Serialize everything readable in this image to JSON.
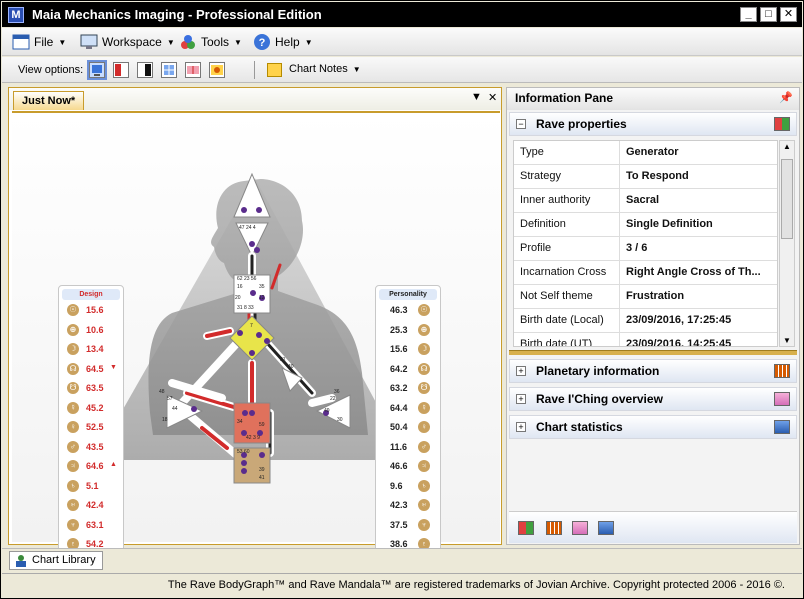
{
  "window": {
    "title": "Maia Mechanics Imaging - Professional Edition",
    "app_icon": "M"
  },
  "menu": {
    "file": "File",
    "workspace": "Workspace",
    "tools": "Tools",
    "help": "Help"
  },
  "toolbar": {
    "view_options": "View options:",
    "chart_notes": "Chart Notes"
  },
  "document": {
    "tab": "Just Now*"
  },
  "design": {
    "header": "Design",
    "rows": [
      {
        "glyph": "☉",
        "value": "15.6",
        "mark": ""
      },
      {
        "glyph": "⊕",
        "value": "10.6",
        "mark": ""
      },
      {
        "glyph": "☽",
        "value": "13.4",
        "mark": ""
      },
      {
        "glyph": "☊",
        "value": "64.5",
        "mark": "▼"
      },
      {
        "glyph": "☋",
        "value": "63.5",
        "mark": ""
      },
      {
        "glyph": "☿",
        "value": "45.2",
        "mark": ""
      },
      {
        "glyph": "♀",
        "value": "52.5",
        "mark": ""
      },
      {
        "glyph": "♂",
        "value": "43.5",
        "mark": ""
      },
      {
        "glyph": "♃",
        "value": "64.6",
        "mark": "▲"
      },
      {
        "glyph": "♄",
        "value": "5.1",
        "mark": ""
      },
      {
        "glyph": "♅",
        "value": "42.4",
        "mark": ""
      },
      {
        "glyph": "♆",
        "value": "63.1",
        "mark": ""
      },
      {
        "glyph": "♇",
        "value": "54.2",
        "mark": ""
      }
    ]
  },
  "personality": {
    "header": "Personality",
    "rows": [
      {
        "glyph": "☉",
        "value": "46.3"
      },
      {
        "glyph": "⊕",
        "value": "25.3"
      },
      {
        "glyph": "☽",
        "value": "15.6"
      },
      {
        "glyph": "☊",
        "value": "64.2"
      },
      {
        "glyph": "☋",
        "value": "63.2"
      },
      {
        "glyph": "☿",
        "value": "64.4"
      },
      {
        "glyph": "♀",
        "value": "50.4"
      },
      {
        "glyph": "♂",
        "value": "11.6"
      },
      {
        "glyph": "♃",
        "value": "46.6"
      },
      {
        "glyph": "♄",
        "value": "9.6"
      },
      {
        "glyph": "♅",
        "value": "42.3"
      },
      {
        "glyph": "♆",
        "value": "37.5"
      },
      {
        "glyph": "♇",
        "value": "38.6"
      }
    ]
  },
  "info_pane": {
    "title": "Information Pane",
    "sections": {
      "rave_properties": "Rave properties",
      "planetary": "Planetary information",
      "iching": "Rave I'Ching overview",
      "stats": "Chart statistics"
    },
    "properties": [
      {
        "key": "Type",
        "value": "Generator"
      },
      {
        "key": "Strategy",
        "value": "To Respond"
      },
      {
        "key": "Inner authority",
        "value": "Sacral"
      },
      {
        "key": "Definition",
        "value": "Single Definition"
      },
      {
        "key": "Profile",
        "value": "3 / 6"
      },
      {
        "key": "Incarnation Cross",
        "value": "Right Angle Cross of Th..."
      },
      {
        "key": "Not Self theme",
        "value": "Frustration"
      },
      {
        "key": "Birth date (Local)",
        "value": "23/09/2016, 17:25:45"
      },
      {
        "key": "Birth date (UT)",
        "value": "23/09/2016, 14:25:45"
      }
    ]
  },
  "library": {
    "tab": "Chart Library"
  },
  "status": {
    "text": "The Rave BodyGraph™ and Rave Mandala™ are registered trademarks of Jovian Archive. Copyright protected 2006 - 2016 ©."
  },
  "colors": {
    "design": "#d22b2b",
    "personality": "#222222",
    "accent": "#c89c2c"
  }
}
